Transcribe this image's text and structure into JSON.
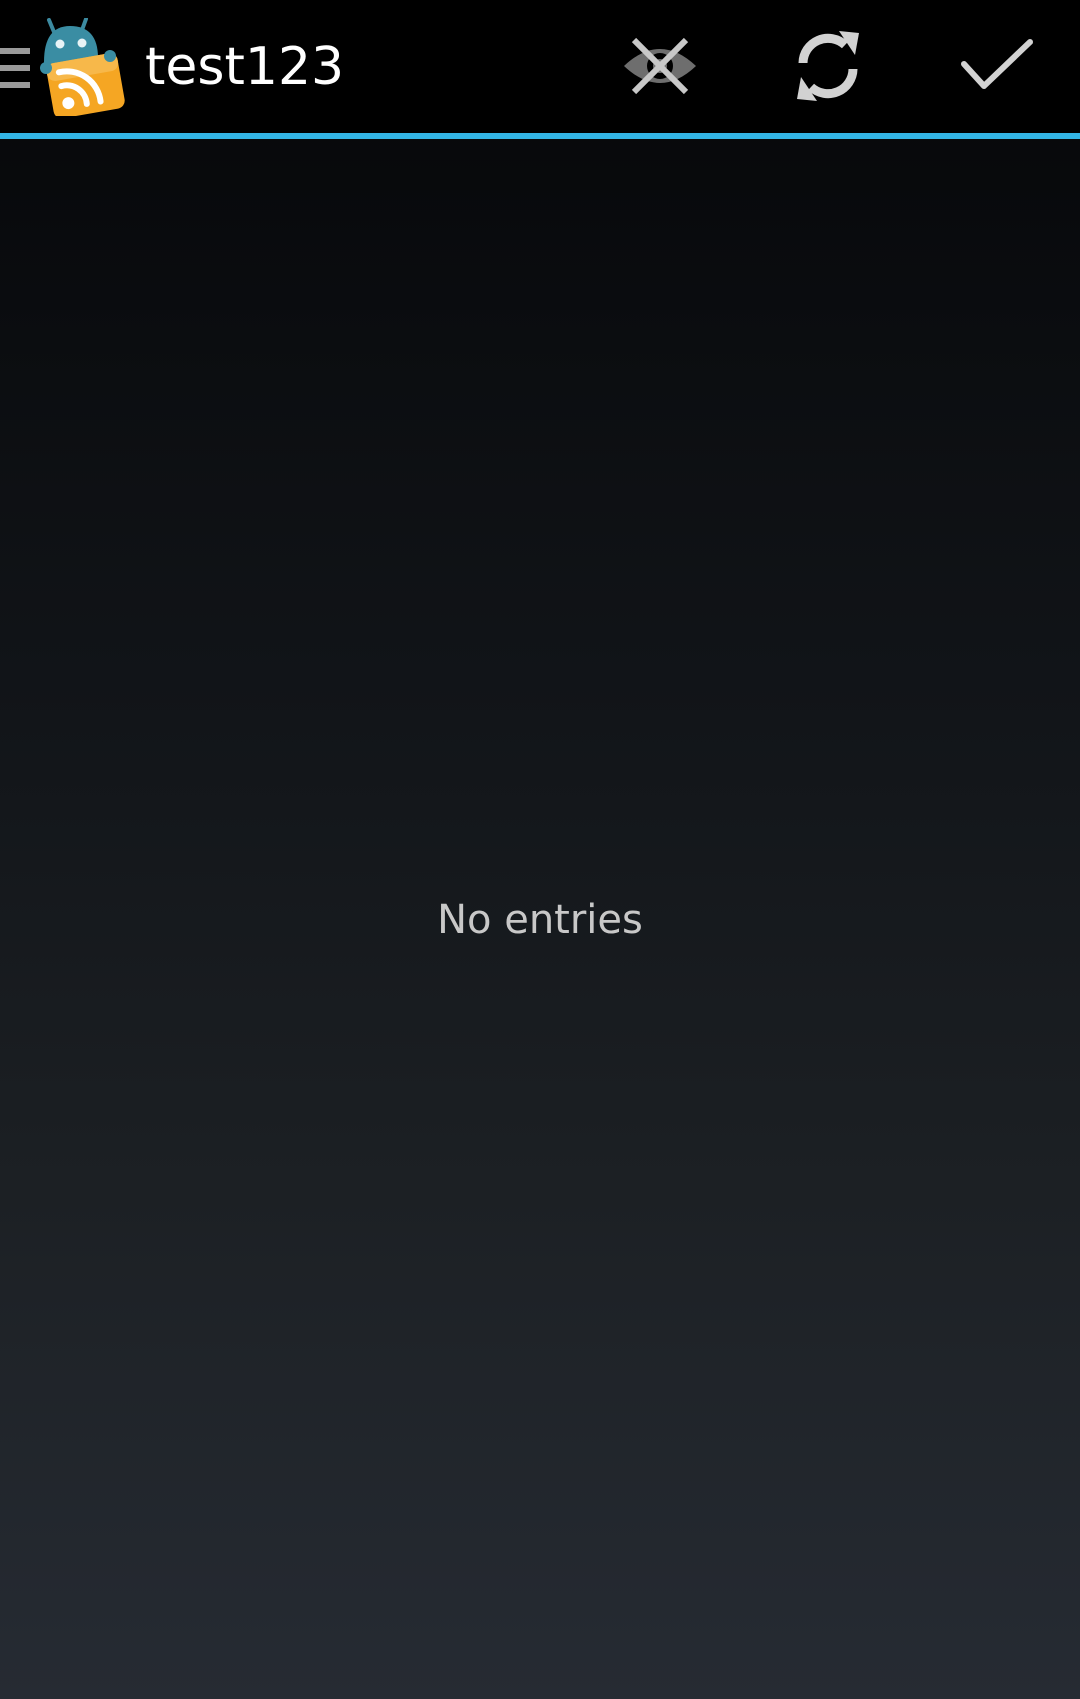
{
  "action_bar": {
    "title": "test123",
    "accent_color": "#33b5e5",
    "icons": {
      "drawer": "menu-icon",
      "logo": "app-logo-icon",
      "hide_read": "eye-crossed-icon",
      "refresh": "refresh-icon",
      "mark_all_read": "checkmark-icon"
    }
  },
  "main": {
    "empty_message": "No entries"
  }
}
